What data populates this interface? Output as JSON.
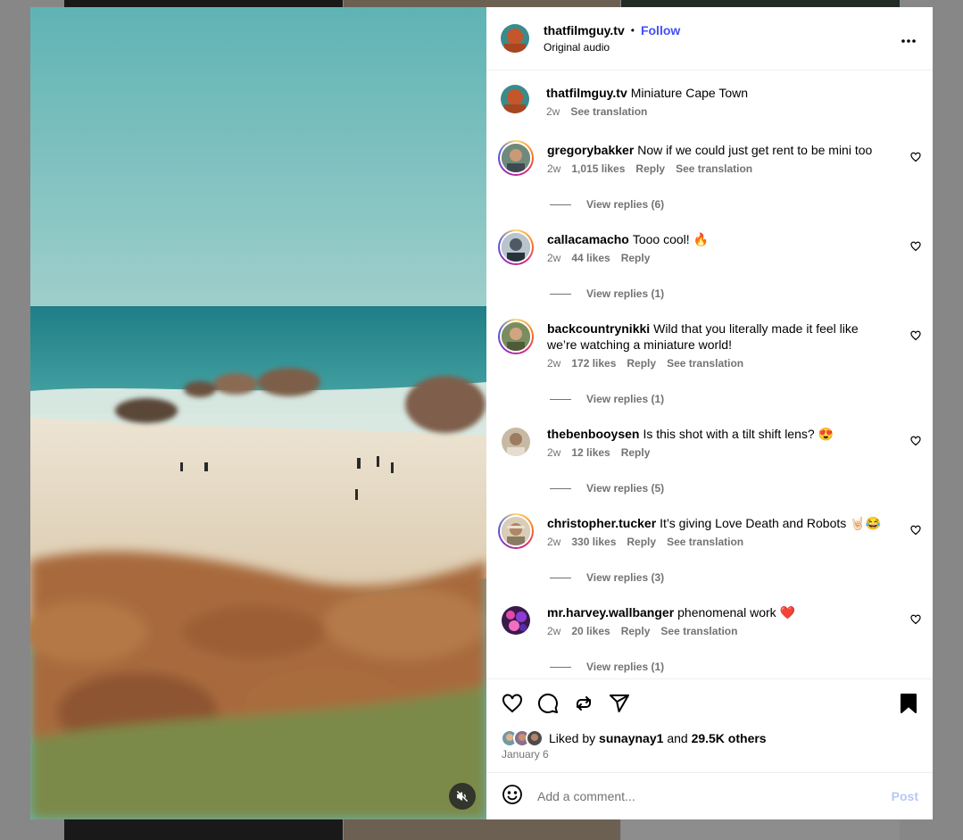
{
  "header": {
    "username": "thatfilmguy.tv",
    "separator": "•",
    "follow_label": "Follow",
    "audio_label": "Original audio"
  },
  "caption": {
    "username": "thatfilmguy.tv",
    "text": "Miniature Cape Town",
    "time": "2w",
    "translate_label": "See translation"
  },
  "comments": [
    {
      "username": "gregorybakker",
      "text": "Now if we could just get rent to be mini too",
      "time": "2w",
      "likes": "1,015 likes",
      "reply": "Reply",
      "translate": "See translation",
      "replies": "View replies (6)"
    },
    {
      "username": "callacamacho",
      "text": "Tooo cool! 🔥",
      "time": "2w",
      "likes": "44 likes",
      "reply": "Reply",
      "translate": "",
      "replies": "View replies (1)"
    },
    {
      "username": "backcountrynikki",
      "text": "Wild that you literally made it feel like we’re watching a miniature world!",
      "time": "2w",
      "likes": "172 likes",
      "reply": "Reply",
      "translate": "See translation",
      "replies": "View replies (1)"
    },
    {
      "username": "thebenbooysen",
      "text": "Is this shot with a tilt shift lens? 😍",
      "time": "2w",
      "likes": "12 likes",
      "reply": "Reply",
      "translate": "",
      "replies": "View replies (5)"
    },
    {
      "username": "christopher.tucker",
      "text": "It’s giving Love Death and Robots 🤘🏻😂",
      "time": "2w",
      "likes": "330 likes",
      "reply": "Reply",
      "translate": "See translation",
      "replies": "View replies (3)"
    },
    {
      "username": "mr.harvey.wallbanger",
      "text": "phenomenal work ❤️",
      "time": "2w",
      "likes": "20 likes",
      "reply": "Reply",
      "translate": "See translation",
      "replies": "View replies (1)"
    }
  ],
  "actions": {
    "icons": [
      "heart-icon",
      "comment-icon",
      "repost-icon",
      "share-icon",
      "bookmark-icon"
    ],
    "liked_by_prefix": "Liked by",
    "liked_by_user": "sunaynay1",
    "liked_by_and": "and",
    "liked_by_others": "29.5K others",
    "date": "January 6"
  },
  "add_comment": {
    "placeholder": "Add a comment...",
    "post_label": "Post"
  },
  "colors": {
    "accent": "#4150f7",
    "post_disabled": "#b5c8f6",
    "secondary_text": "#737373"
  }
}
